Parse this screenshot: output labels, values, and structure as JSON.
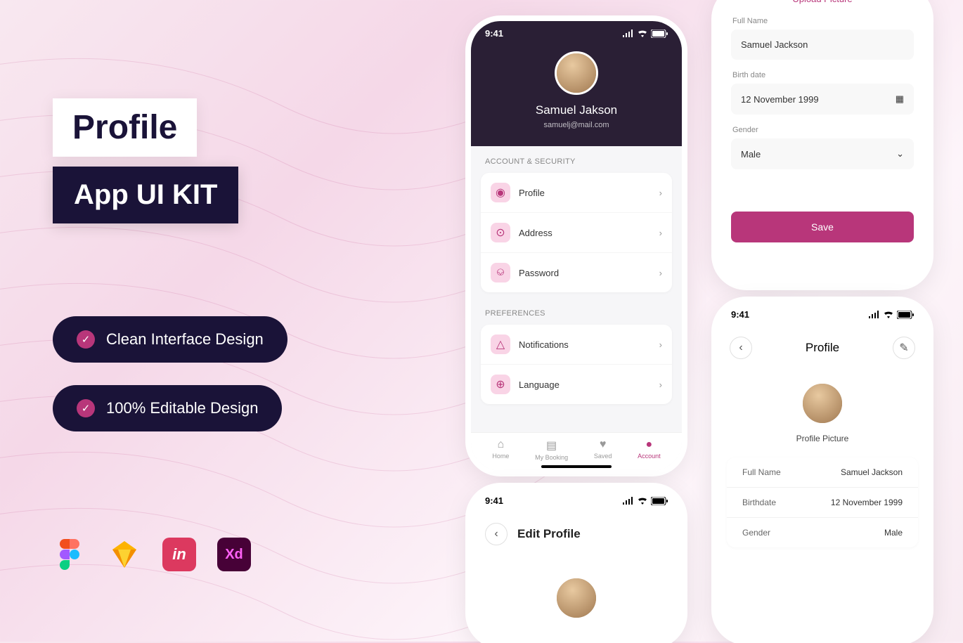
{
  "promo": {
    "title1": "Profile",
    "title2": "App UI KIT"
  },
  "pills": {
    "p1": "Clean Interface Design",
    "p2": "100% Editable Design"
  },
  "statusbar": {
    "time": "9:41"
  },
  "phone1": {
    "name": "Samuel Jakson",
    "email": "samuelj@mail.com",
    "sec1": "ACCOUNT & SECURITY",
    "items1": [
      "Profile",
      "Address",
      "Password"
    ],
    "sec2": "PREFERENCES",
    "items2": [
      "Notifications",
      "Language"
    ],
    "nav": [
      "Home",
      "My Booking",
      "Saved",
      "Account"
    ]
  },
  "phone2": {
    "title": "Edit Profile"
  },
  "phone3": {
    "upload": "Upload Picture",
    "f1_label": "Full Name",
    "f1_value": "Samuel Jackson",
    "f2_label": "Birth date",
    "f2_value": "12 November 1999",
    "f3_label": "Gender",
    "f3_value": "Male",
    "save": "Save"
  },
  "phone4": {
    "title": "Profile",
    "pic_label": "Profile Picture",
    "rows": [
      {
        "k": "Full Name",
        "v": "Samuel Jackson"
      },
      {
        "k": "Birthdate",
        "v": "12 November 1999"
      },
      {
        "k": "Gender",
        "v": "Male"
      }
    ]
  }
}
